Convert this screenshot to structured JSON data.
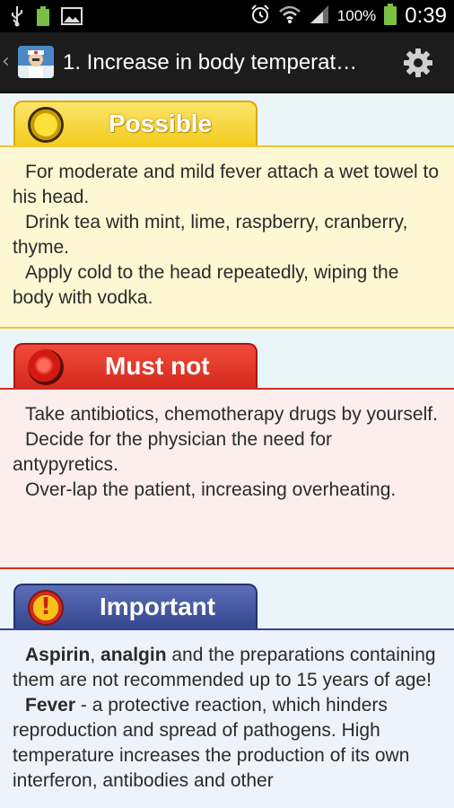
{
  "status_bar": {
    "battery_percent": "100%",
    "time": "0:39",
    "icons_left": [
      "usb-icon",
      "battery-notification-icon",
      "image-icon"
    ],
    "icons_right": [
      "alarm-icon",
      "wifi-icon",
      "signal-icon",
      "battery-icon"
    ]
  },
  "action_bar": {
    "title": "1. Increase in body temperat…",
    "up_icon": "chevron-left-icon",
    "settings_icon": "gear-icon"
  },
  "colors": {
    "possible": "#f5d93a",
    "must_not": "#e8392b",
    "important": "#3b4f9e"
  },
  "sections": {
    "possible": {
      "label": "Possible",
      "paragraphs": [
        "For moderate and mild fever attach a wet towel to his head.",
        "Drink tea with mint, lime, raspberry, cranberry, thyme.",
        "Apply cold to the head repeatedly, wiping the body with vodka."
      ]
    },
    "must_not": {
      "label": "Must not",
      "paragraphs": [
        "Take antibiotics, chemotherapy drugs by yourself.",
        "Decide for the physician the need for antypyretics.",
        "Over-lap the patient, increasing overheating."
      ]
    },
    "important": {
      "label": "Important",
      "p1_bold1": "Aspirin",
      "p1_sep": ", ",
      "p1_bold2": "analgin",
      "p1_rest": " and the preparations containing them are not recommended up to 15 years of age!",
      "p2_bold": "Fever",
      "p2_rest": " - a protective reaction, which hinders reproduction and spread of pathogens. High temperature increases the production of its own interferon, antibodies and other"
    }
  }
}
